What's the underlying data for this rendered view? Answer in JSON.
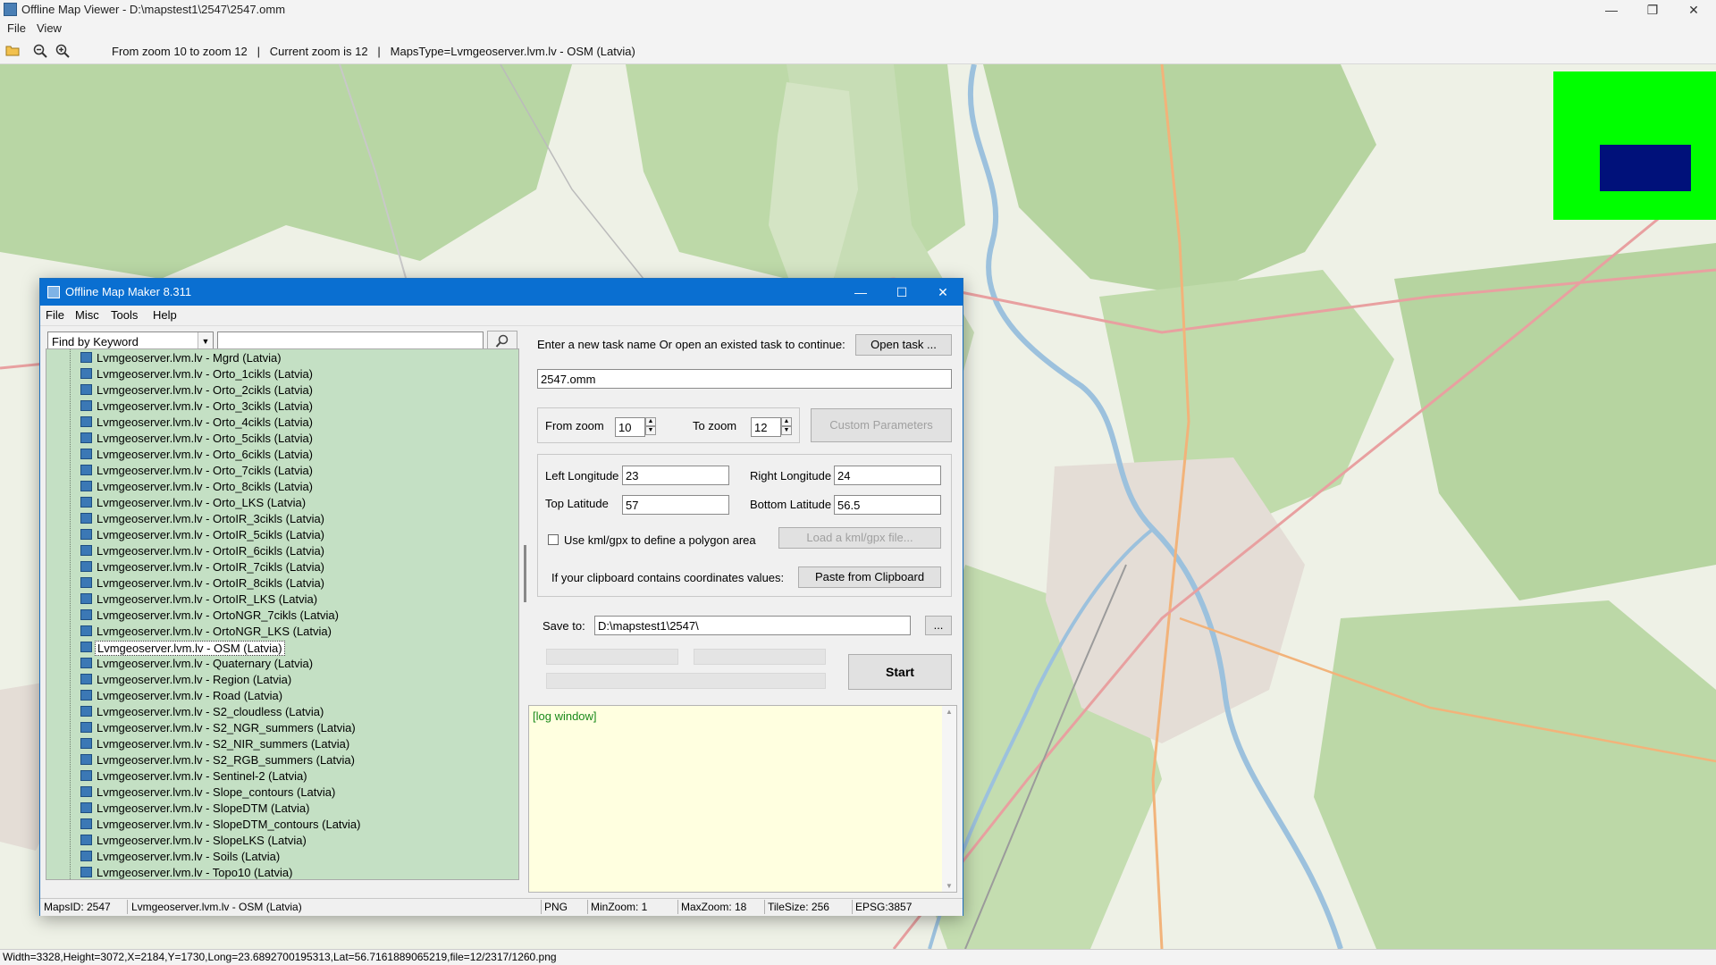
{
  "window": {
    "title": "Offline Map Viewer - D:\\mapstest1\\2547\\2547.omm",
    "minimize": "—",
    "maximize": "❐",
    "close": "✕"
  },
  "menu": {
    "file": "File",
    "view": "View"
  },
  "toolbar": {
    "info": "From zoom 10 to zoom 12   |   Current zoom is 12   |   MapsType=Lvmgeoserver.lvm.lv - OSM (Latvia)"
  },
  "status": {
    "text": "Width=3328,Height=3072,X=2184,Y=1730,Long=23.6892700195313,Lat=56.7161889065219,file=12/2317/1260.png"
  },
  "colors": {
    "overview_bg": "#00ff00",
    "overview_box": "#00117a",
    "dialog_title": "#0a6fd1",
    "tree_bg": "#c4e0c4",
    "log_bg": "#ffffe0"
  },
  "dialog": {
    "title": "Offline Map Maker 8.311",
    "minimize": "—",
    "maximize": "☐",
    "close": "✕",
    "menu": {
      "file": "File",
      "misc": "Misc",
      "tools": "Tools",
      "help": "Help"
    },
    "find": {
      "mode": "Find by Keyword",
      "query": ""
    },
    "maps": [
      "Lvmgeoserver.lvm.lv - Mgrd (Latvia)",
      "Lvmgeoserver.lvm.lv - Orto_1cikls (Latvia)",
      "Lvmgeoserver.lvm.lv - Orto_2cikls (Latvia)",
      "Lvmgeoserver.lvm.lv - Orto_3cikls (Latvia)",
      "Lvmgeoserver.lvm.lv - Orto_4cikls (Latvia)",
      "Lvmgeoserver.lvm.lv - Orto_5cikls (Latvia)",
      "Lvmgeoserver.lvm.lv - Orto_6cikls (Latvia)",
      "Lvmgeoserver.lvm.lv - Orto_7cikls (Latvia)",
      "Lvmgeoserver.lvm.lv - Orto_8cikls (Latvia)",
      "Lvmgeoserver.lvm.lv - Orto_LKS (Latvia)",
      "Lvmgeoserver.lvm.lv - OrtoIR_3cikls (Latvia)",
      "Lvmgeoserver.lvm.lv - OrtoIR_5cikls (Latvia)",
      "Lvmgeoserver.lvm.lv - OrtoIR_6cikls (Latvia)",
      "Lvmgeoserver.lvm.lv - OrtoIR_7cikls (Latvia)",
      "Lvmgeoserver.lvm.lv - OrtoIR_8cikls (Latvia)",
      "Lvmgeoserver.lvm.lv - OrtoIR_LKS (Latvia)",
      "Lvmgeoserver.lvm.lv - OrtoNGR_7cikls (Latvia)",
      "Lvmgeoserver.lvm.lv - OrtoNGR_LKS (Latvia)",
      "Lvmgeoserver.lvm.lv - OSM (Latvia)",
      "Lvmgeoserver.lvm.lv - Quaternary (Latvia)",
      "Lvmgeoserver.lvm.lv - Region (Latvia)",
      "Lvmgeoserver.lvm.lv - Road (Latvia)",
      "Lvmgeoserver.lvm.lv - S2_cloudless (Latvia)",
      "Lvmgeoserver.lvm.lv - S2_NGR_summers (Latvia)",
      "Lvmgeoserver.lvm.lv - S2_NIR_summers (Latvia)",
      "Lvmgeoserver.lvm.lv - S2_RGB_summers (Latvia)",
      "Lvmgeoserver.lvm.lv - Sentinel-2 (Latvia)",
      "Lvmgeoserver.lvm.lv - Slope_contours (Latvia)",
      "Lvmgeoserver.lvm.lv - SlopeDTM (Latvia)",
      "Lvmgeoserver.lvm.lv - SlopeDTM_contours (Latvia)",
      "Lvmgeoserver.lvm.lv - SlopeLKS (Latvia)",
      "Lvmgeoserver.lvm.lv - Soils (Latvia)",
      "Lvmgeoserver.lvm.lv - Topo10 (Latvia)"
    ],
    "selected_map": "Lvmgeoserver.lvm.lv - OSM (Latvia)",
    "task_prompt": "Enter a new task name Or open an existed task to continue:",
    "open_task": "Open task ...",
    "task_name": "2547.omm",
    "from_zoom_label": "From zoom",
    "from_zoom": "10",
    "to_zoom_label": "To zoom",
    "to_zoom": "12",
    "custom_params": "Custom Parameters",
    "left_lon_label": "Left Longitude",
    "left_lon": "23",
    "right_lon_label": "Right Longitude",
    "right_lon": "24",
    "top_lat_label": "Top Latitude",
    "top_lat": "57",
    "bottom_lat_label": "Bottom Latitude",
    "bottom_lat": "56.5",
    "kml_label": "Use kml/gpx to define a polygon area",
    "load_kml": "Load a kml/gpx file...",
    "clipboard_label": "If your clipboard contains coordinates values:",
    "paste": "Paste from Clipboard",
    "save_label": "Save to:",
    "save_path": "D:\\mapstest1\\2547\\",
    "browse": "...",
    "start": "Start",
    "log": "[log window]",
    "status": {
      "maps_id": "MapsID: 2547",
      "map_name": "Lvmgeoserver.lvm.lv - OSM (Latvia)",
      "format": "PNG",
      "min_zoom": "MinZoom: 1",
      "max_zoom": "MaxZoom: 18",
      "tile_size": "TileSize: 256",
      "epsg": "EPSG:3857"
    }
  }
}
